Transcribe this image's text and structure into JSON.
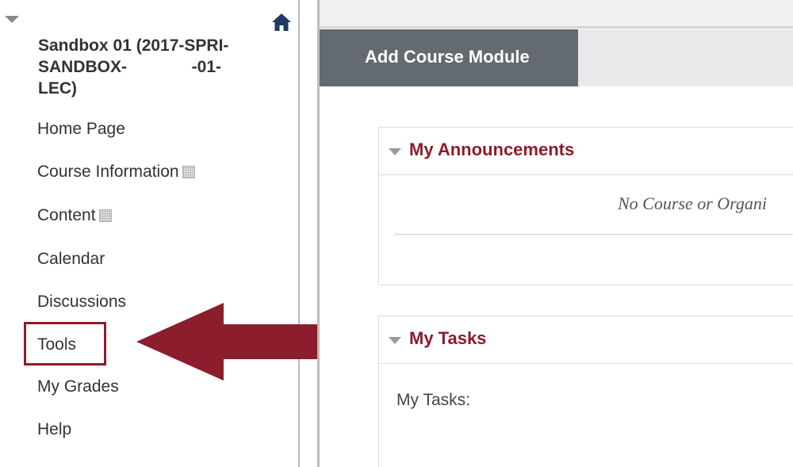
{
  "sidebar": {
    "course_title_lines": [
      "Sandbox 01 (2017-SPRI-",
      "SANDBOX-              -01-",
      "LEC)"
    ],
    "items": [
      {
        "label": "Home Page",
        "has_submenu": false
      },
      {
        "label": "Course Information",
        "has_submenu": true
      },
      {
        "label": "Content",
        "has_submenu": true
      },
      {
        "label": "Calendar",
        "has_submenu": false
      },
      {
        "label": "Discussions",
        "has_submenu": false
      },
      {
        "label": "Tools",
        "has_submenu": false,
        "highlighted": true
      },
      {
        "label": "My Grades",
        "has_submenu": false
      },
      {
        "label": "Help",
        "has_submenu": false
      }
    ],
    "icons": [
      "collapse-toggle",
      "home-icon",
      "submenu-icon"
    ]
  },
  "main": {
    "add_module_label": "Add Course Module",
    "modules": {
      "announcements": {
        "title": "My Announcements",
        "message": "No Course or Organi"
      },
      "tasks": {
        "title": "My Tasks",
        "body_label": "My Tasks:"
      }
    }
  },
  "colors": {
    "accent": "#8c1d2c",
    "tab_button": "#636a70",
    "home_icon": "#1f3a63",
    "text": "#333333"
  }
}
